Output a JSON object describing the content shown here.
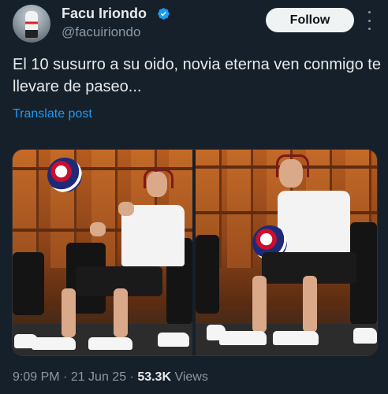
{
  "author": {
    "name": "Facu Iriondo",
    "handle": "@facuiriondo",
    "verified": true
  },
  "follow_label": "Follow",
  "post": {
    "text": "El 10 susurro a su oido, novia eterna ven conmigo te llevare de paseo...",
    "translate_label": "Translate post"
  },
  "meta": {
    "time": "9:09 PM",
    "sep1": " · ",
    "date": "21 Jun 25",
    "sep2": " · ",
    "views_count": "53.3K",
    "views_label": " Views"
  },
  "colors": {
    "background": "#15202b",
    "accent": "#1d9bf0",
    "verified": "#1d9bf0",
    "muted": "#8b98a5"
  },
  "icons": {
    "verified": "verified-badge-icon",
    "more": "more-dots-icon"
  }
}
